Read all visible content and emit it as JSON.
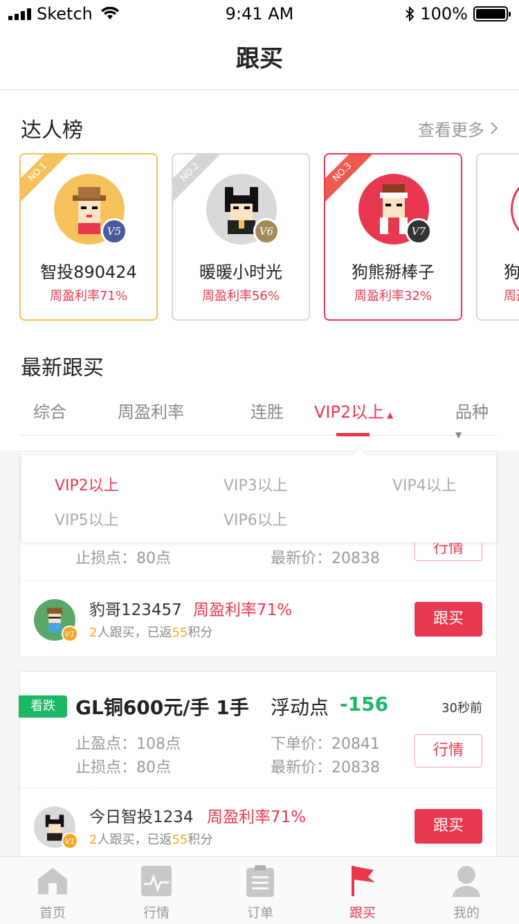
{
  "status_bar": {
    "carrier": "Sketch",
    "time": "9:41 AM",
    "battery": "100%"
  },
  "nav": {
    "title": "跟买"
  },
  "leaderboard": {
    "title": "达人榜",
    "more_label": "查看更多",
    "cards": [
      {
        "rank": "NO.1",
        "name": "智投890424",
        "rate": "周盈利率71%",
        "level": "V5",
        "level_color": "#4a5a9c",
        "rank_color": "#f5c15a"
      },
      {
        "rank": "NO.2",
        "name": "暖暖小时光",
        "rate": "周盈利率56%",
        "level": "V6",
        "level_color": "#a38a58",
        "rank_color": "#d5d5d5"
      },
      {
        "rank": "NO.3",
        "name": "狗熊掰棒子",
        "rate": "周盈利率32%",
        "level": "V7",
        "level_color": "#333333",
        "rank_color": "#ef5a4f"
      },
      {
        "rank": "",
        "name": "狗",
        "rate": "周盈",
        "level": "",
        "level_color": "#333333",
        "rank_color": "#e8384f"
      }
    ]
  },
  "latest": {
    "title": "最新跟买",
    "tabs": [
      {
        "label": "综合"
      },
      {
        "label": "周盈利率"
      },
      {
        "label": "连胜"
      },
      {
        "label": "VIP2以上"
      },
      {
        "label": "品种"
      }
    ]
  },
  "dropdown": {
    "options": [
      "VIP2以上",
      "VIP3以上",
      "VIP4以上",
      "VIP5以上",
      "VIP6以上"
    ]
  },
  "trades": [
    {
      "partial_stop_loss": "止损点：80点",
      "partial_latest": "最新价：20838",
      "partial_btn": "行情",
      "user": "豹哥123457",
      "user_rate": "周盈利率71%",
      "followers": "2",
      "follow_mid": "人跟买，已返",
      "points": "55",
      "points_unit": "积分",
      "follow_btn": "跟买"
    },
    {
      "direction": "看跌",
      "product": "GL铜600元/手 1手",
      "float_label": "浮动点",
      "float_value": "-156",
      "time_ago": "30秒前",
      "take_profit": "止盈点：108点",
      "stop_loss": "止损点：80点",
      "order_price": "下单价：20841",
      "latest_price": "最新价：20838",
      "quote_btn": "行情",
      "user": "今日智投1234",
      "user_rate": "周盈利率71%",
      "followers": "2",
      "follow_mid": "人跟买，已返",
      "points": "55",
      "points_unit": "积分",
      "follow_btn": "跟买"
    }
  ],
  "tab_bar": {
    "items": [
      {
        "label": "首页",
        "icon": "home-icon"
      },
      {
        "label": "行情",
        "icon": "chart-icon"
      },
      {
        "label": "订单",
        "icon": "clipboard-icon"
      },
      {
        "label": "跟买",
        "icon": "flag-icon"
      },
      {
        "label": "我的",
        "icon": "user-icon"
      }
    ],
    "active_color": "#e8384f"
  }
}
